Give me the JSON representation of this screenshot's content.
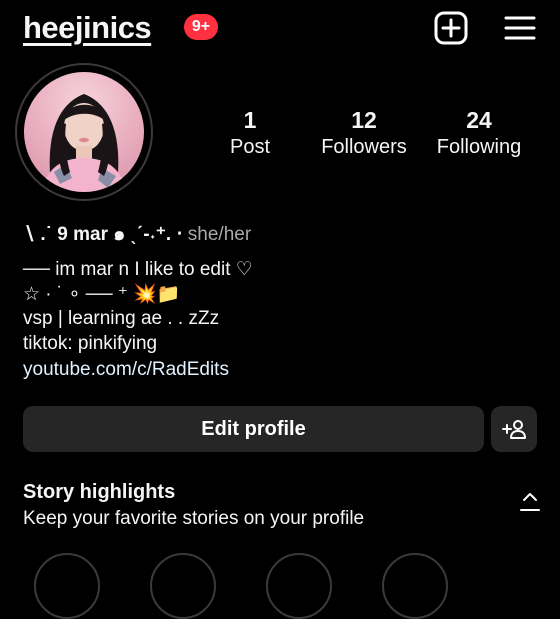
{
  "header": {
    "username": "heejinics",
    "notification_count": "9+",
    "new_post_icon": "plus-square-icon",
    "menu_icon": "hamburger-menu-icon"
  },
  "profile": {
    "avatar_icon": "profile-avatar",
    "stats": [
      {
        "number": "1",
        "label": "Post"
      },
      {
        "number": "12",
        "label": "Followers"
      },
      {
        "number": "24",
        "label": "Following"
      }
    ]
  },
  "bio": {
    "name_line": "∖ .˙ 9 mar ๑ ˎˊ-˖⁺. ‧",
    "pronouns": "she/her",
    "line1": "── im mar n I like to edit ♡",
    "line2": "☆ · ˙ ∘ ── ⁺ 💥📁",
    "line3": "vsp | learning ae . . zZz",
    "line4": "tiktok: pinkifying",
    "link": "youtube.com/c/RadEdits"
  },
  "actions": {
    "edit_profile_label": "Edit profile",
    "add_person_icon": "add-person-icon"
  },
  "highlights": {
    "title": "Story highlights",
    "subtitle": "Keep your favorite stories on your profile"
  },
  "colors": {
    "background": "#000000",
    "badge": "#ff3040",
    "button": "#262626",
    "muted": "#a8a8a8"
  }
}
